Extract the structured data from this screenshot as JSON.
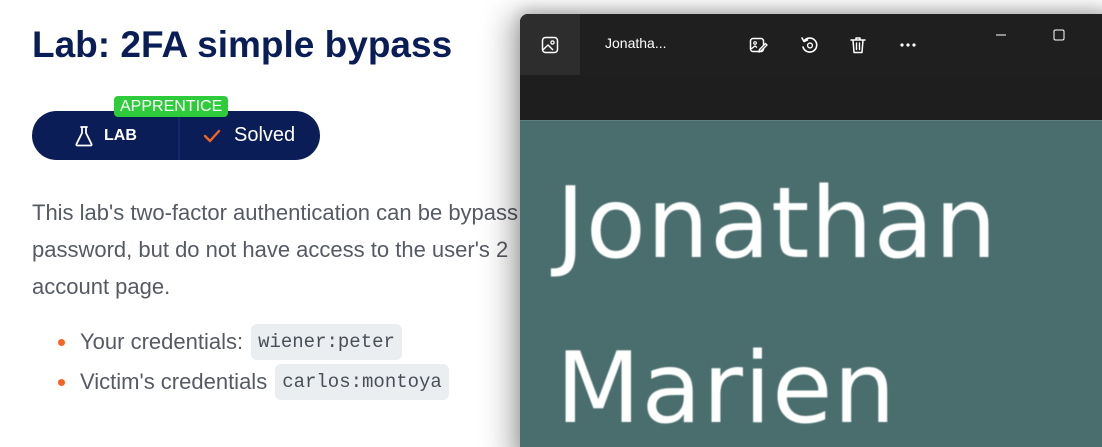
{
  "lab": {
    "title": "Lab: 2FA simple bypass",
    "level": "APPRENTICE",
    "badge_label": "LAB",
    "status": "Solved",
    "description": "This lab's two-factor authentication can be bypass password, but do not have access to the user's 2 account page.",
    "credentials": [
      {
        "label": "Your credentials:",
        "value": "wiener:peter"
      },
      {
        "label": "Victim's credentials",
        "value": "carlos:montoya"
      }
    ],
    "colors": {
      "title": "#0a1d57",
      "pill": "#0a1d57",
      "level_badge": "#2ecc3a",
      "check": "#f26522",
      "bullet": "#f26522"
    }
  },
  "viewer": {
    "filename": "Jonatha...",
    "toolbar": {
      "app_icon": "photo-icon",
      "edit_icon": "edit-image-icon",
      "rotate_icon": "rotate-icon",
      "delete_icon": "trash-icon",
      "more_icon": "more-icon"
    },
    "window_controls": {
      "minimize_icon": "minimize-icon",
      "maximize_icon": "maximize-icon"
    },
    "image": {
      "line1": "Jonathan",
      "line2": "Marien",
      "background": "#4a6e6e"
    }
  }
}
